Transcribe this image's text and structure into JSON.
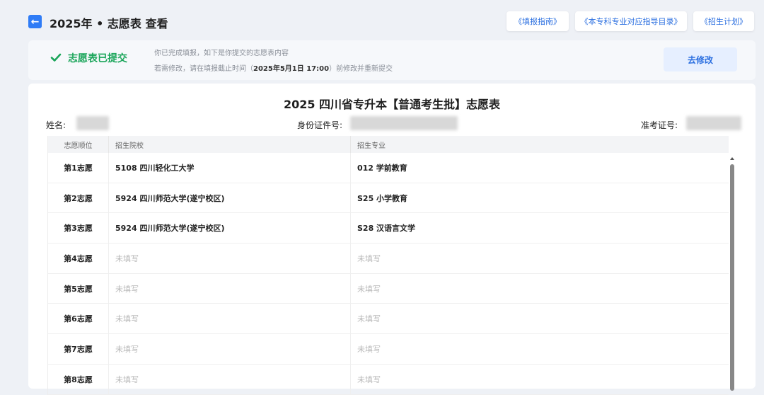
{
  "header": {
    "title": "2025年 • 志愿表 查看",
    "guide_links": [
      "《填报指南》",
      "《本专科专业对应指导目录》",
      "《招生计划》"
    ]
  },
  "status": {
    "title": "志愿表已提交",
    "line1": "你已完成填报，如下是你提交的志愿表内容",
    "line2_prefix": "若需修改，请在填报截止时间（",
    "deadline": "2025年5月1日 17:00",
    "line2_suffix": "）前修改并重新提交",
    "modify_label": "去修改",
    "accent_color": "#1aa55a"
  },
  "form": {
    "title": "2025 四川省专升本【普通考生批】志愿表",
    "name_label": "姓名:",
    "id_label": "身份证件号:",
    "exam_label": "准考证号:"
  },
  "table": {
    "headers": [
      "志愿顺位",
      "招生院校",
      "招生专业"
    ],
    "rows": [
      {
        "rank": "第1志愿",
        "school": "5108 四川轻化工大学",
        "major": "012 学前教育"
      },
      {
        "rank": "第2志愿",
        "school": "5924 四川师范大学(遂宁校区)",
        "major": "S25 小学教育"
      },
      {
        "rank": "第3志愿",
        "school": "5924 四川师范大学(遂宁校区)",
        "major": "S28 汉语言文学"
      },
      {
        "rank": "第4志愿",
        "school": "未填写",
        "major": "未填写"
      },
      {
        "rank": "第5志愿",
        "school": "未填写",
        "major": "未填写"
      },
      {
        "rank": "第6志愿",
        "school": "未填写",
        "major": "未填写"
      },
      {
        "rank": "第7志愿",
        "school": "未填写",
        "major": "未填写"
      },
      {
        "rank": "第8志愿",
        "school": "未填写",
        "major": "未填写"
      }
    ]
  }
}
